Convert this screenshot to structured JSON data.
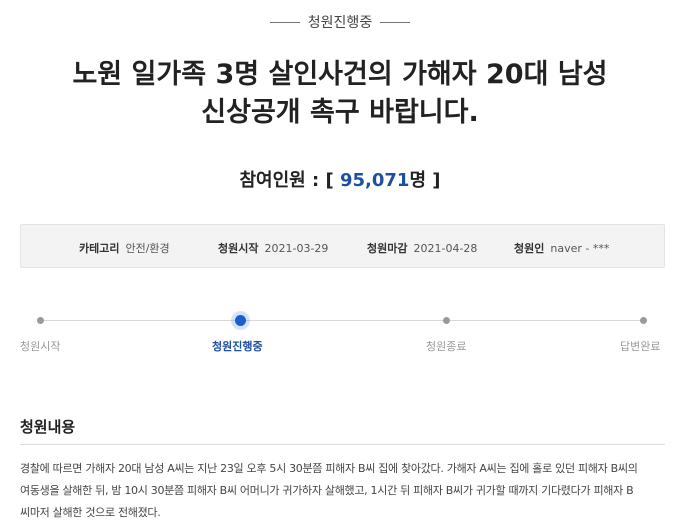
{
  "status": "청원진행중",
  "title": {
    "line1": "노원 일가족 3명 살인사건의 가해자 20대 남성",
    "line2": "신상공개 촉구 바랍니다."
  },
  "participants": {
    "label": "참여인원 : [ ",
    "value": "95,071",
    "suffix": "명 ]"
  },
  "info": {
    "category_label": "카테고리",
    "category_value": "안전/환경",
    "start_label": "청원시작",
    "start_value": "2021-03-29",
    "end_label": "청원마감",
    "end_value": "2021-04-28",
    "petitioner_label": "청원인",
    "petitioner_value": "naver - ***"
  },
  "progress": {
    "active_index": 1,
    "steps": [
      "청원시작",
      "청원진행중",
      "청원종료",
      "답변완료"
    ]
  },
  "section": {
    "title": "청원내용",
    "lines": [
      "경찰에 따르면 가해자 20대 남성 A씨는 지난 23일 오후 5시 30분쯤 피해자 B씨 집에 찾아갔다. 가해자 A씨는 집에 홀로 있던 피해자 B씨의",
      "여동생을 살해한 뒤, 밤 10시 30분쯤 피해자 B씨 어머니가 귀가하자 살해했고, 1시간 뒤 피해자 B씨가 귀가할 때까지 기다렸다가 피해자 B",
      "씨마저 살해한 것으로 전해졌다."
    ]
  },
  "colors": {
    "accent": "#1f4f9f",
    "active_dot": "#1a5fd0",
    "info_bg": "#f3f3f3"
  }
}
